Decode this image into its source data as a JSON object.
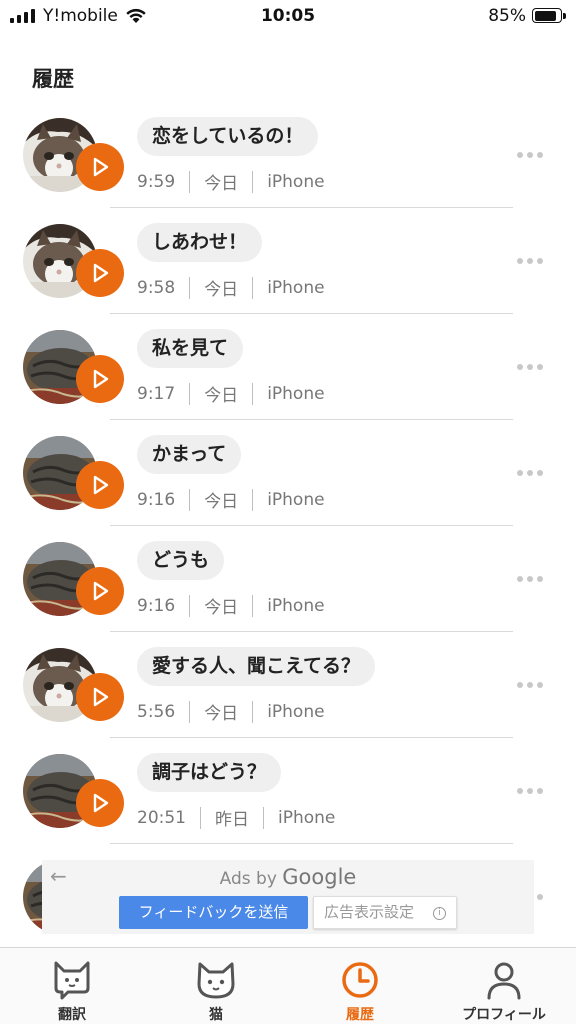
{
  "status_bar": {
    "carrier": "Y!mobile",
    "time": "10:05",
    "battery": "85%"
  },
  "page": {
    "title": "履歴"
  },
  "history": [
    {
      "phrase": "恋をしているの！",
      "time": "9:59",
      "day": "今日",
      "device": "iPhone",
      "cat": "tabby-white"
    },
    {
      "phrase": "しあわせ！",
      "time": "9:58",
      "day": "今日",
      "device": "iPhone",
      "cat": "tabby-white"
    },
    {
      "phrase": "私を見て",
      "time": "9:17",
      "day": "今日",
      "device": "iPhone",
      "cat": "tabby-dark"
    },
    {
      "phrase": "かまって",
      "time": "9:16",
      "day": "今日",
      "device": "iPhone",
      "cat": "tabby-dark"
    },
    {
      "phrase": "どうも",
      "time": "9:16",
      "day": "今日",
      "device": "iPhone",
      "cat": "tabby-dark"
    },
    {
      "phrase": "愛する人、聞こえてる？",
      "time": "5:56",
      "day": "今日",
      "device": "iPhone",
      "cat": "tabby-white"
    },
    {
      "phrase": "調子はどう？",
      "time": "20:51",
      "day": "昨日",
      "device": "iPhone",
      "cat": "tabby-dark"
    }
  ],
  "ad": {
    "ads_by": "Ads by",
    "google": "Google",
    "feedback_button": "フィードバックを送信",
    "settings_button": "広告表示設定",
    "info_glyph": "i"
  },
  "tabs": [
    {
      "label": "翻訳",
      "icon": "speech-cat-icon",
      "active": false
    },
    {
      "label": "猫",
      "icon": "cat-face-icon",
      "active": false
    },
    {
      "label": "履歴",
      "icon": "clock-icon",
      "active": true
    },
    {
      "label": "プロフィール",
      "icon": "person-icon",
      "active": false
    }
  ],
  "colors": {
    "accent": "#ea6a12",
    "bubble": "#efefef",
    "ad_button": "#4a89e8"
  }
}
